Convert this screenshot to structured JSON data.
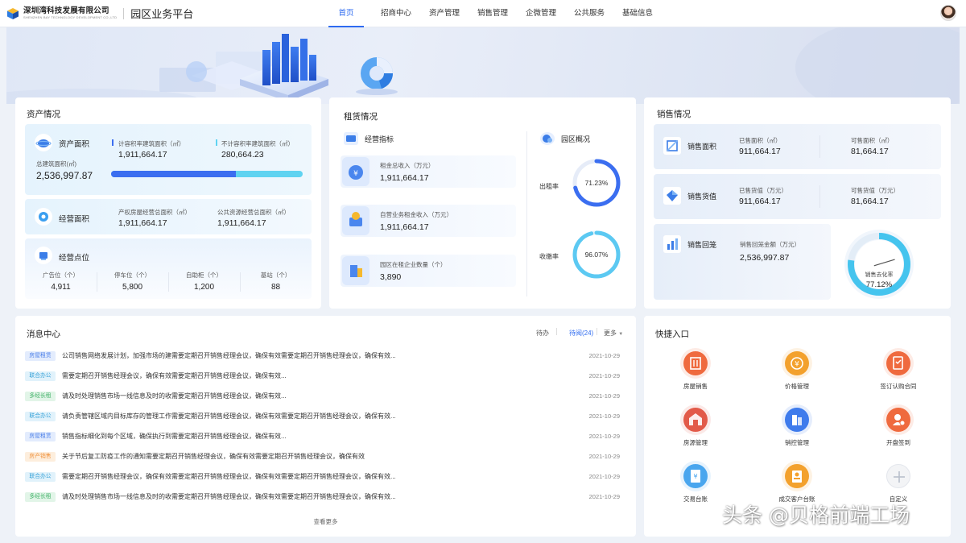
{
  "header": {
    "company": "深圳湾科技发展有限公司",
    "company_en": "SHENZHEN BAY TECHNOLOGY DEVELOPMENT CO.,LTD",
    "platform": "园区业务平台",
    "nav": [
      "首页",
      "招商中心",
      "资产管理",
      "销售管理",
      "企微管理",
      "公共服务",
      "基础信息"
    ],
    "active_nav": "首页"
  },
  "assets": {
    "title": "资产情况",
    "area": {
      "title": "资产面积",
      "total_label": "总建筑面积(㎡)",
      "total_value": "2,536,997.87",
      "counted_label": "计容积率建筑面积（㎡）",
      "counted_value": "1,911,664.17",
      "uncounted_label": "不计容积率建筑面积（㎡）",
      "uncounted_value": "280,664.23",
      "counted_share": 0.65
    },
    "operation": {
      "title": "经营面积",
      "property_label": "产权房屋经营总面积（㎡）",
      "property_value": "1,911,664.17",
      "public_label": "公共资源经营总面积（㎡）",
      "public_value": "1,911,664.17"
    },
    "points": {
      "title": "经营点位",
      "items": [
        {
          "label": "广告位（个）",
          "value": "4,911"
        },
        {
          "label": "停车位（个）",
          "value": "5,800"
        },
        {
          "label": "自助柜（个）",
          "value": "1,200"
        },
        {
          "label": "基站（个）",
          "value": "88"
        }
      ]
    }
  },
  "lease": {
    "title": "租赁情况",
    "indicators_title": "经营指标",
    "indicators": [
      {
        "label": "租金总收入（万元）",
        "value": "1,911,664.17"
      },
      {
        "label": "自营业务租金收入（万元）",
        "value": "1,911,664.17"
      },
      {
        "label": "园区在租企业数量（个）",
        "value": "3,890"
      }
    ],
    "overview_title": "园区概况",
    "rates": [
      {
        "label": "出租率",
        "value": "71.23%",
        "fraction": 0.7123,
        "color": "#3b6ef0"
      },
      {
        "label": "收缴率",
        "value": "96.07%",
        "fraction": 0.9607,
        "color": "#5cc9f2"
      }
    ]
  },
  "sales": {
    "title": "销售情况",
    "area": {
      "title": "销售面积",
      "sold_label": "已售面积（㎡）",
      "sold_value": "911,664.17",
      "avail_label": "可售面积（㎡）",
      "avail_value": "81,664.17"
    },
    "value": {
      "title": "销售货值",
      "sold_label": "已售货值（万元）",
      "sold_value": "911,664.17",
      "avail_label": "可售货值（万元）",
      "avail_value": "81,664.17"
    },
    "payback": {
      "title": "销售回笼",
      "label": "销售回笼金额（万元）",
      "value": "2,536,997.87"
    },
    "gauge": {
      "label": "销售去化率",
      "value": "77.12%",
      "fraction": 0.7712
    }
  },
  "messages": {
    "title": "消息中心",
    "tabs": [
      "待办",
      "待阅(24)",
      "更多"
    ],
    "active_tab": "待阅(24)",
    "items": [
      {
        "tag": "房屋租赁",
        "tag_color": "#4a7ee8",
        "tag_bg": "#e3ecfd",
        "text": "公司销售网络发展计划，加强市场的建需要定期召开销售经理会议，确保有效需要定期召开销售经理会议，确保有效...",
        "date": "2021-10-29"
      },
      {
        "tag": "联合办公",
        "tag_color": "#3aa3d8",
        "tag_bg": "#e1f2fb",
        "text": "需要定期召开销售经理会议，确保有效需要定期召开销售经理会议，确保有效...",
        "date": "2021-10-29"
      },
      {
        "tag": "多经长租",
        "tag_color": "#45b36b",
        "tag_bg": "#e2f5e8",
        "text": "请及时处理销售市场一线信息及时的收需要定期召开销售经理会议，确保有效...",
        "date": "2021-10-29"
      },
      {
        "tag": "联合办公",
        "tag_color": "#3aa3d8",
        "tag_bg": "#e1f2fb",
        "text": "请负责管辖区域内目标库存的管理工作需要定期召开销售经理会议，确保有效需要定期召开销售经理会议，确保有效...",
        "date": "2021-10-29"
      },
      {
        "tag": "房屋租赁",
        "tag_color": "#4a7ee8",
        "tag_bg": "#e3ecfd",
        "text": "销售指标细化到每个区域，确保执行到需要定期召开销售经理会议，确保有效...",
        "date": "2021-10-29"
      },
      {
        "tag": "房产销售",
        "tag_color": "#f0913a",
        "tag_bg": "#fdeedd",
        "text": "关于节后复工防疫工作的通知需要定期召开销售经理会议，确保有效需要定期召开销售经理会议，确保有效",
        "date": "2021-10-29"
      },
      {
        "tag": "联合办公",
        "tag_color": "#3aa3d8",
        "tag_bg": "#e1f2fb",
        "text": "需要定期召开销售经理会议，确保有效需要定期召开销售经理会议，确保有效需要定期召开销售经理会议，确保有效...",
        "date": "2021-10-29"
      },
      {
        "tag": "多经长租",
        "tag_color": "#45b36b",
        "tag_bg": "#e2f5e8",
        "text": "请及时处理销售市场一线信息及时的收需要定期召开销售经理会议，确保有效需要定期召开销售经理会议，确保有效...",
        "date": "2021-10-29"
      }
    ],
    "view_more": "查看更多"
  },
  "quick": {
    "title": "快捷入口",
    "items": [
      {
        "label": "房屋销售",
        "icon": "building-icon",
        "color": "#ef6a3e"
      },
      {
        "label": "价格管理",
        "icon": "price-icon",
        "color": "#f3a12d"
      },
      {
        "label": "签订认购合同",
        "icon": "contract-icon",
        "color": "#ef6a3e"
      },
      {
        "label": "房源管理",
        "icon": "house-icon",
        "color": "#e25a49"
      },
      {
        "label": "销控管理",
        "icon": "sales-control-icon",
        "color": "#3e7bec"
      },
      {
        "label": "开盘签到",
        "icon": "sign-in-icon",
        "color": "#ef6a3e"
      },
      {
        "label": "交易台账",
        "icon": "ledger-icon",
        "color": "#4aa6ee"
      },
      {
        "label": "成交客户台账",
        "icon": "customer-ledger-icon",
        "color": "#f3a12d"
      },
      {
        "label": "自定义",
        "icon": "plus-icon",
        "color": "#f3f4f6"
      }
    ]
  },
  "watermark": "头条 @贝格前端工场"
}
